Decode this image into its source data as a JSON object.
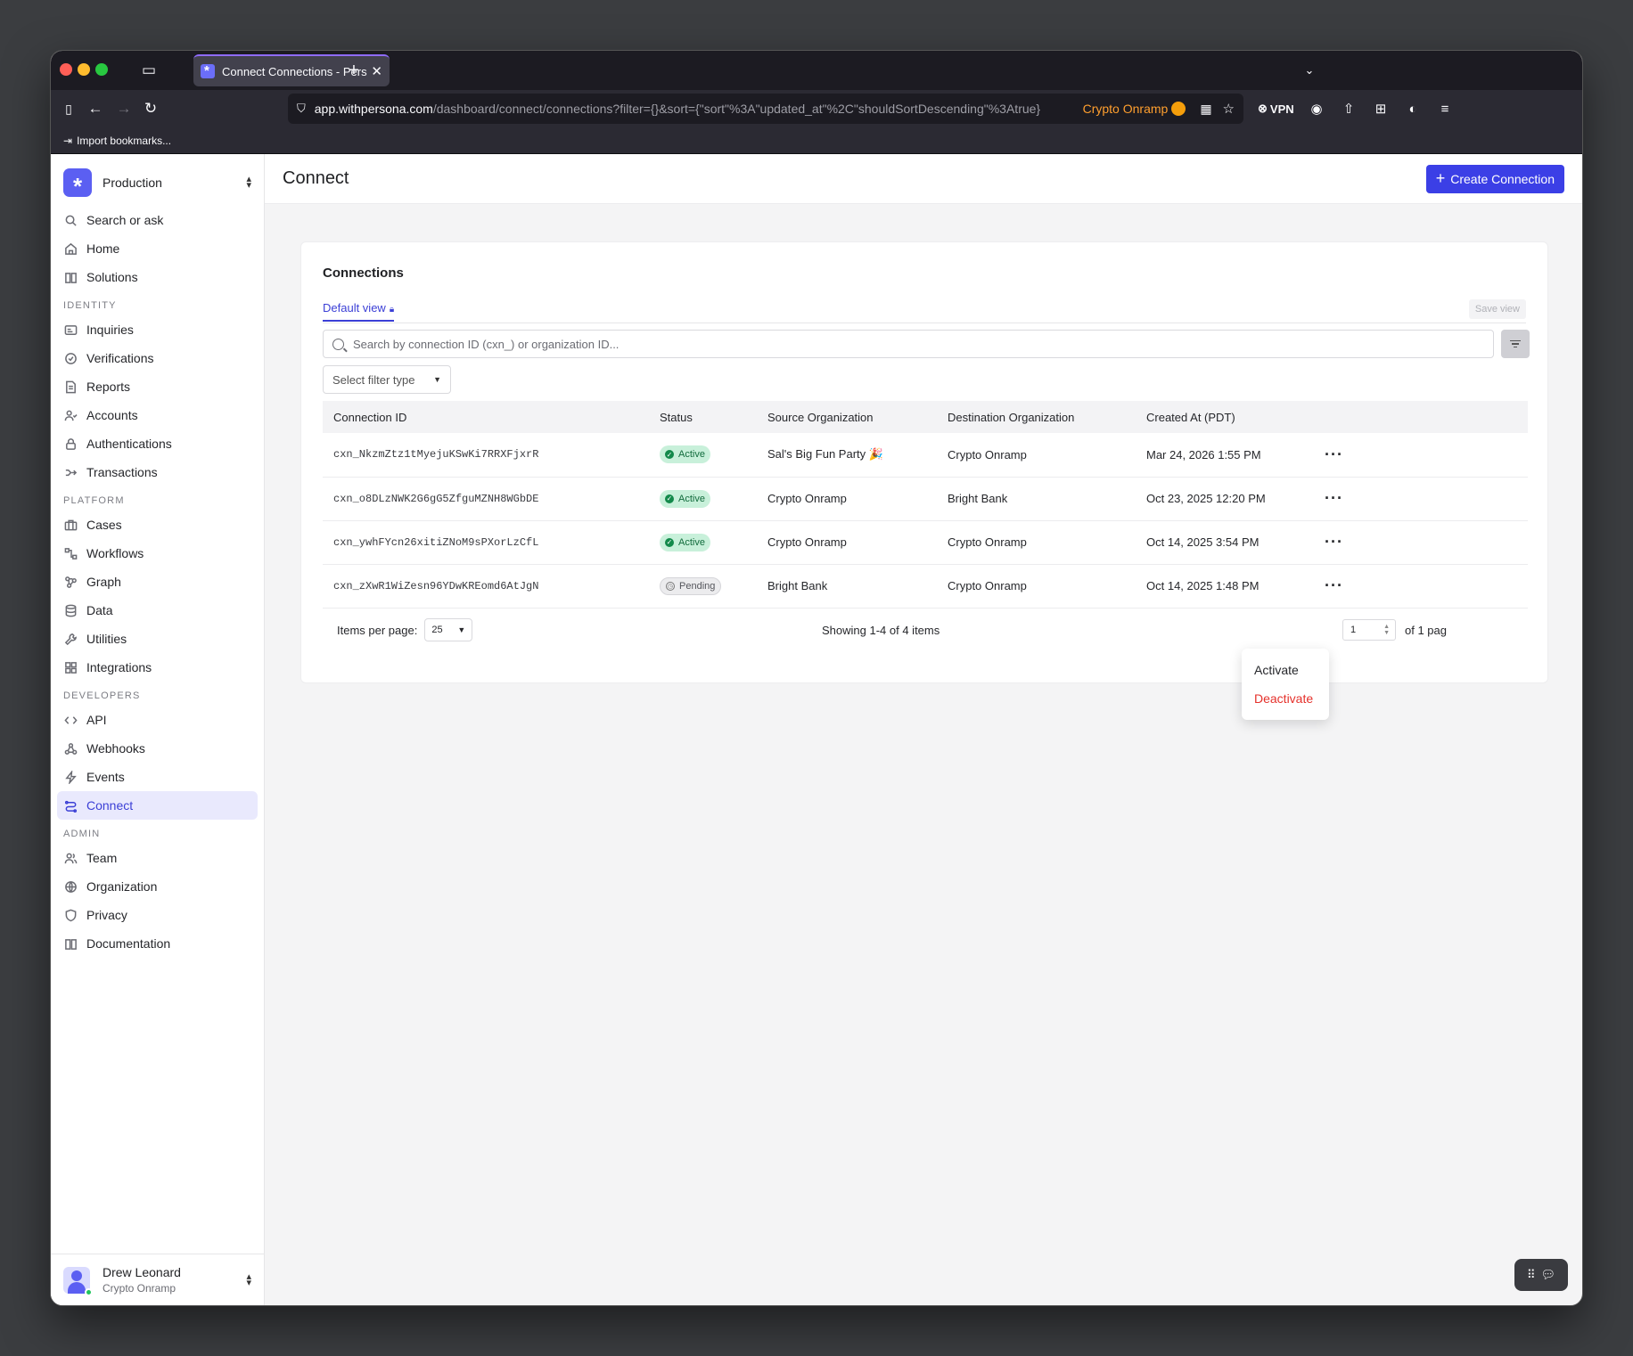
{
  "browser": {
    "tab_title": "Connect Connections - Persona",
    "url_host": "app.withpersona.com",
    "url_rest": "/dashboard/connect/connections?filter={}&sort={\"sort\"%3A\"updated_at\"%2C\"shouldSortDescending\"%3Atrue}",
    "extension_label": "Crypto Onramp",
    "vpn_label": "VPN",
    "bookmark_label": "Import bookmarks..."
  },
  "sidebar": {
    "env_name": "Production",
    "top_items": [
      {
        "label": "Search or ask",
        "icon": "search-icon"
      },
      {
        "label": "Home",
        "icon": "home-icon"
      },
      {
        "label": "Solutions",
        "icon": "book-icon"
      }
    ],
    "sections": [
      {
        "label": "IDENTITY",
        "items": [
          {
            "label": "Inquiries",
            "icon": "id-card-icon"
          },
          {
            "label": "Verifications",
            "icon": "check-circle-icon"
          },
          {
            "label": "Reports",
            "icon": "document-icon"
          },
          {
            "label": "Accounts",
            "icon": "user-check-icon"
          },
          {
            "label": "Authentications",
            "icon": "lock-icon"
          },
          {
            "label": "Transactions",
            "icon": "arrow-right-icon"
          }
        ]
      },
      {
        "label": "PLATFORM",
        "items": [
          {
            "label": "Cases",
            "icon": "briefcase-icon"
          },
          {
            "label": "Workflows",
            "icon": "workflow-icon"
          },
          {
            "label": "Graph",
            "icon": "graph-icon"
          },
          {
            "label": "Data",
            "icon": "database-icon"
          },
          {
            "label": "Utilities",
            "icon": "wrench-icon"
          },
          {
            "label": "Integrations",
            "icon": "grid-icon"
          }
        ]
      },
      {
        "label": "DEVELOPERS",
        "items": [
          {
            "label": "API",
            "icon": "code-icon"
          },
          {
            "label": "Webhooks",
            "icon": "webhook-icon"
          },
          {
            "label": "Events",
            "icon": "bolt-icon"
          },
          {
            "label": "Connect",
            "icon": "connect-icon"
          }
        ]
      },
      {
        "label": "ADMIN",
        "items": [
          {
            "label": "Team",
            "icon": "users-icon"
          },
          {
            "label": "Organization",
            "icon": "globe-icon"
          },
          {
            "label": "Privacy",
            "icon": "shield-icon"
          },
          {
            "label": "Documentation",
            "icon": "book-icon"
          }
        ]
      }
    ],
    "active_item": "Connect",
    "user": {
      "name": "Drew Leonard",
      "org": "Crypto Onramp"
    }
  },
  "header": {
    "title": "Connect",
    "create_button": "Create Connection"
  },
  "card": {
    "title": "Connections",
    "view_tab": "Default view",
    "save_view": "Save view",
    "search_placeholder": "Search by connection ID (cxn_) or organization ID...",
    "filter_placeholder": "Select filter type"
  },
  "table": {
    "columns": [
      "Connection ID",
      "Status",
      "Source Organization",
      "Destination Organization",
      "Created At (PDT)"
    ],
    "rows": [
      {
        "id": "cxn_NkzmZtz1tMyejuKSwKi7RRXFjxrR",
        "status": "Active",
        "source": "Sal's Big Fun Party 🎉",
        "destination": "Crypto Onramp",
        "created": "Mar 24, 2026 1:55 PM"
      },
      {
        "id": "cxn_o8DLzNWK2G6gG5ZfguMZNH8WGbDE",
        "status": "Active",
        "source": "Crypto Onramp",
        "destination": "Bright Bank",
        "created": "Oct 23, 2025 12:20 PM"
      },
      {
        "id": "cxn_ywhFYcn26xitiZNoM9sPXorLzCfL",
        "status": "Active",
        "source": "Crypto Onramp",
        "destination": "Crypto Onramp",
        "created": "Oct 14, 2025 3:54 PM"
      },
      {
        "id": "cxn_zXwR1WiZesn96YDwKREomd6AtJgN",
        "status": "Pending",
        "source": "Bright Bank",
        "destination": "Crypto Onramp",
        "created": "Oct 14, 2025 1:48 PM"
      }
    ]
  },
  "pagination": {
    "items_per_page_label": "Items per page:",
    "items_per_page": "25",
    "showing": "Showing 1-4 of 4 items",
    "page": "1",
    "of_pages": "of 1 pag"
  },
  "row_menu": {
    "activate": "Activate",
    "deactivate": "Deactivate"
  },
  "colors": {
    "accent": "#3b3fe6",
    "danger": "#e5312b",
    "active_badge": "#c8f0da"
  }
}
